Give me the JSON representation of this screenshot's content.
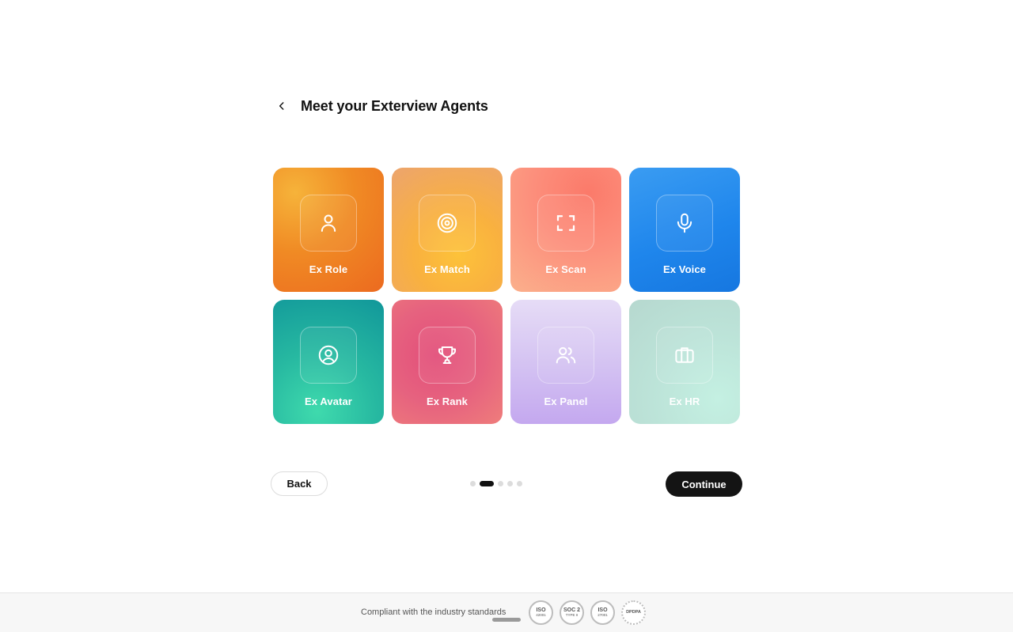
{
  "header": {
    "title": "Meet your Exterview Agents"
  },
  "agents": [
    {
      "label": "Ex Role",
      "icon": "user-icon"
    },
    {
      "label": "Ex Match",
      "icon": "target-icon"
    },
    {
      "label": "Ex Scan",
      "icon": "scan-frame-icon"
    },
    {
      "label": "Ex Voice",
      "icon": "microphone-icon"
    },
    {
      "label": "Ex Avatar",
      "icon": "user-circle-icon"
    },
    {
      "label": "Ex Rank",
      "icon": "trophy-icon"
    },
    {
      "label": "Ex Panel",
      "icon": "users-icon"
    },
    {
      "label": "Ex HR",
      "icon": "briefcase-icon"
    }
  ],
  "nav": {
    "back_label": "Back",
    "continue_label": "Continue",
    "total_steps": 5,
    "active_step": 2
  },
  "footer": {
    "text": "Compliant with the industry standards",
    "badges": [
      {
        "line1": "ISO",
        "line2": "42001"
      },
      {
        "line1": "SOC 2",
        "line2": "TYPE II"
      },
      {
        "line1": "ISO",
        "line2": "27001"
      },
      {
        "line1": "DPDPA",
        "line2": ""
      }
    ]
  }
}
